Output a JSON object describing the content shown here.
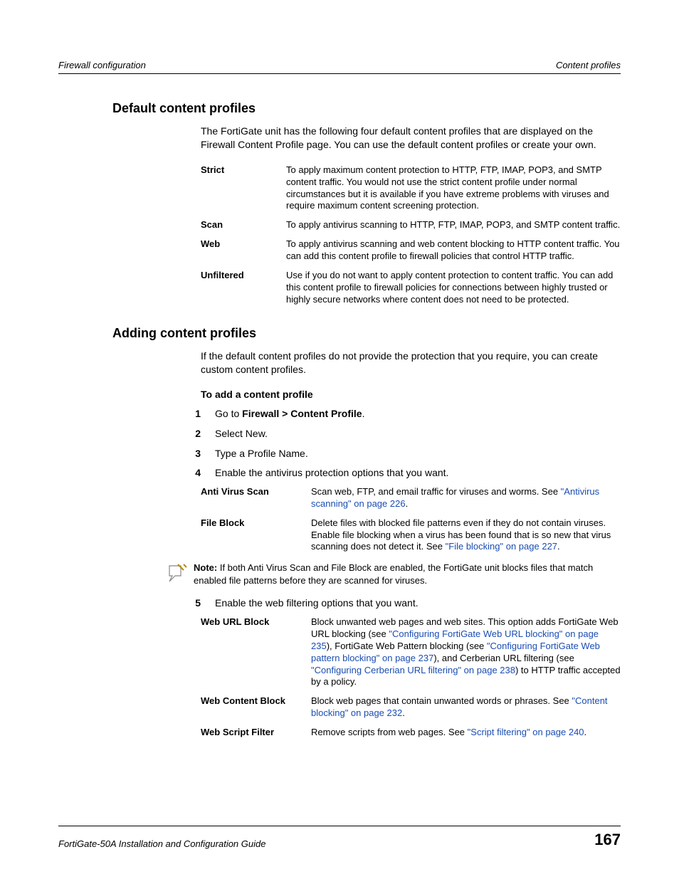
{
  "header": {
    "left": "Firewall configuration",
    "right": "Content profiles"
  },
  "section1": {
    "title": "Default content profiles",
    "intro": "The FortiGate unit has the following four default content profiles that are displayed on the Firewall Content Profile page. You can use the default content profiles or create your own.",
    "profiles": {
      "strict": {
        "term": "Strict",
        "desc": "To apply maximum content protection to HTTP, FTP, IMAP, POP3, and SMTP content traffic. You would not use the strict content profile under normal circumstances but it is available if you have extreme problems with viruses and require maximum content screening protection."
      },
      "scan": {
        "term": "Scan",
        "desc": "To apply antivirus scanning to HTTP, FTP, IMAP, POP3, and SMTP content traffic."
      },
      "web": {
        "term": "Web",
        "desc": "To apply antivirus scanning and web content blocking to HTTP content traffic. You can add this content profile to firewall policies that control HTTP traffic."
      },
      "unfiltered": {
        "term": "Unfiltered",
        "desc": "Use if you do not want to apply content protection to content traffic. You can add this content profile to firewall policies for connections between highly trusted or highly secure networks where content does not need to be protected."
      }
    }
  },
  "section2": {
    "title": "Adding content profiles",
    "intro": "If the default content profiles do not provide the protection that you require, you can create custom content profiles.",
    "subheading": "To add a content profile",
    "steps": {
      "s1": {
        "num": "1",
        "prefix": "Go to ",
        "bold": "Firewall > Content Profile",
        "suffix": "."
      },
      "s2": {
        "num": "2",
        "text": "Select New."
      },
      "s3": {
        "num": "3",
        "text": "Type a Profile Name."
      },
      "s4": {
        "num": "4",
        "text": "Enable the antivirus protection options that you want."
      },
      "s5": {
        "num": "5",
        "text": "Enable the web filtering options that you want."
      }
    },
    "av_options": {
      "scan": {
        "term": "Anti Virus Scan",
        "desc_pre": "Scan web, FTP, and email traffic for viruses and worms. See ",
        "link": "\"Antivirus scanning\" on page 226",
        "desc_post": "."
      },
      "fileblock": {
        "term": "File Block",
        "desc_pre": "Delete files with blocked file patterns even if they do not contain viruses. Enable file blocking when a virus has been found that is so new that virus scanning does not detect it. See ",
        "link": "\"File blocking\" on page 227",
        "desc_post": "."
      }
    },
    "note": {
      "label": "Note:",
      "text": " If both Anti Virus Scan and File Block are enabled, the FortiGate unit blocks files that match enabled file patterns before they are scanned for viruses."
    },
    "web_options": {
      "urlblock": {
        "term": "Web URL Block",
        "p1": "Block unwanted web pages and web sites. This option adds FortiGate Web URL blocking (see ",
        "l1": "\"Configuring FortiGate Web URL blocking\" on page 235",
        "p2": "), FortiGate Web Pattern blocking (see ",
        "l2": "\"Configuring FortiGate Web pattern blocking\" on page 237",
        "p3": "), and Cerberian URL filtering (see ",
        "l3": "\"Configuring Cerberian URL filtering\" on page 238",
        "p4": ") to HTTP traffic accepted by a policy."
      },
      "contentblock": {
        "term": "Web Content Block",
        "p1": "Block web pages that contain unwanted words or phrases. See ",
        "l1": "\"Content blocking\" on page 232",
        "p2": "."
      },
      "scriptfilter": {
        "term": "Web Script Filter",
        "p1": "Remove scripts from web pages. See ",
        "l1": "\"Script filtering\" on page 240",
        "p2": "."
      }
    }
  },
  "footer": {
    "left": "FortiGate-50A Installation and Configuration Guide",
    "right": "167"
  }
}
